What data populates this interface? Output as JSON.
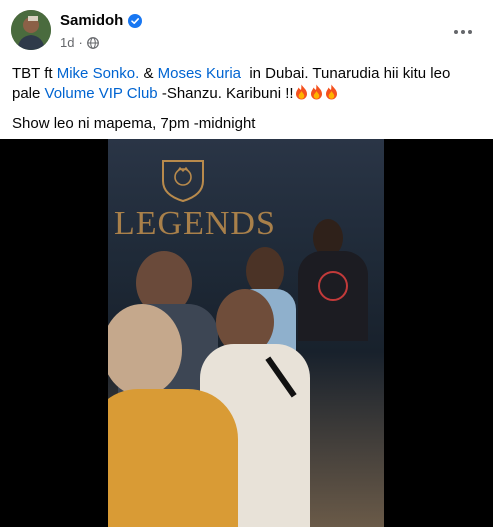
{
  "post": {
    "author": "Samidoh",
    "time": "1d",
    "line1_pre": "TBT ft ",
    "mention1": "Mike Sonko.",
    "line1_amp": " & ",
    "mention2": "Moses Kuria",
    "line1_post": "  in Dubai. Tunarudia hii kitu leo pale ",
    "mention3": "Volume VIP Club",
    "line1_end": " -Shanzu. Karibuni !!",
    "line2": "Show leo ni mapema, 7pm -midnight"
  },
  "video": {
    "logo_text": "LEGENDS"
  },
  "icons": {
    "verified": "verified-badge-icon",
    "privacy": "globe-icon",
    "menu": "more-options-icon",
    "emoji": "fire-icon"
  },
  "colors": {
    "link": "#0064d1",
    "meta": "#65676b",
    "verified": "#1877f2",
    "video_bg": "#000000"
  }
}
